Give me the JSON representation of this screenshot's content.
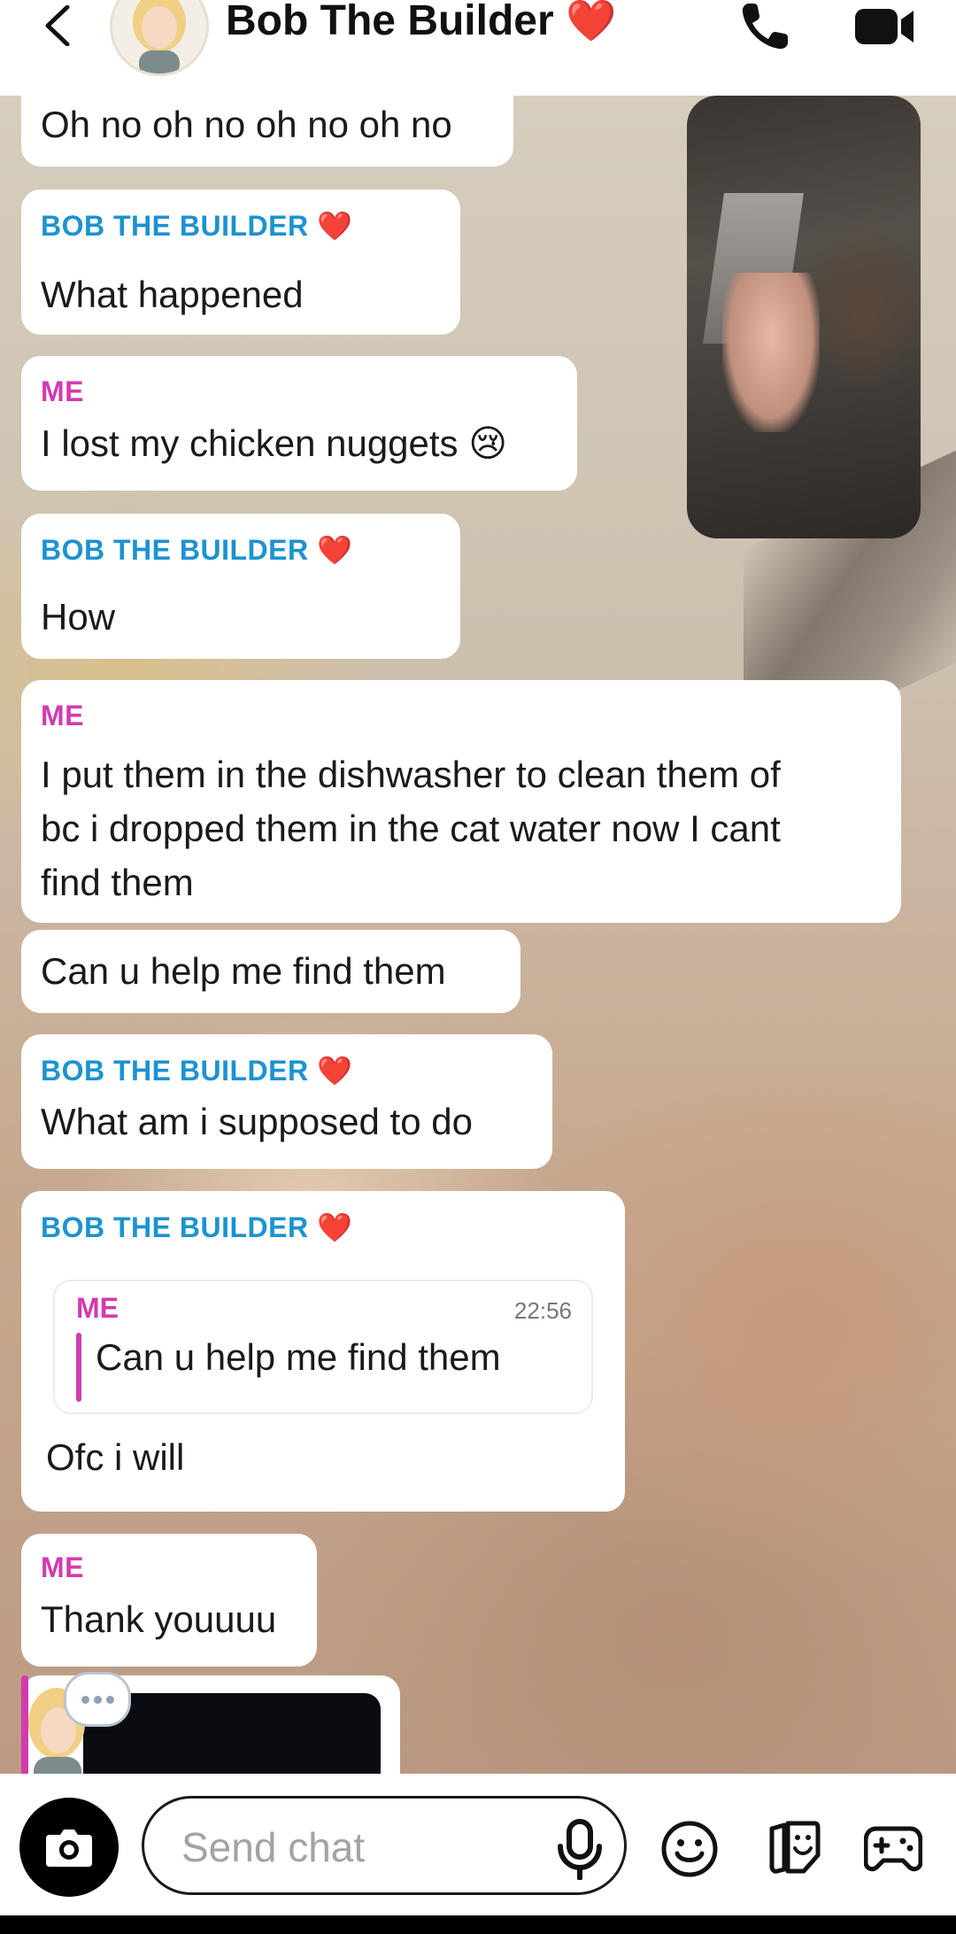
{
  "header": {
    "contact_name": "Bob The Builder",
    "heart": "❤️",
    "back_icon": "chevron-left-icon",
    "call_icon": "phone-icon",
    "video_icon": "video-camera-icon"
  },
  "messages": [
    {
      "sender": "",
      "text": "Oh no oh no oh no oh no"
    },
    {
      "sender": "BOB THE BUILDER",
      "text": "What happened"
    },
    {
      "sender": "ME",
      "text": "I lost my chicken nuggets 😢"
    },
    {
      "sender": "BOB THE BUILDER",
      "text": "How"
    },
    {
      "sender": "ME",
      "lines": [
        "I put them in the dishwasher to clean them of",
        "bc i dropped them in the cat water  now I cant",
        "find them"
      ]
    },
    {
      "sender": "",
      "text": "Can u help me find them"
    },
    {
      "sender": "BOB THE BUILDER",
      "text": "What am i supposed to do"
    },
    {
      "sender": "BOB THE BUILDER",
      "quote": {
        "sender": "ME",
        "time": "22:56",
        "text": "Can u help me find them"
      },
      "text": "Ofc i will"
    },
    {
      "sender": "ME",
      "text": "Thank youuuu"
    }
  ],
  "typing_indicator": "typing-bubble-icon",
  "composer": {
    "placeholder": "Send chat",
    "camera_icon": "camera-icon",
    "mic_icon": "microphone-icon",
    "emoji_icon": "emoji-icon",
    "sticker_icon": "sticker-icon",
    "game_icon": "game-controller-icon"
  },
  "colors": {
    "bob": "#1c93d0",
    "me": "#d13bb0",
    "heart": "#f0295e"
  }
}
